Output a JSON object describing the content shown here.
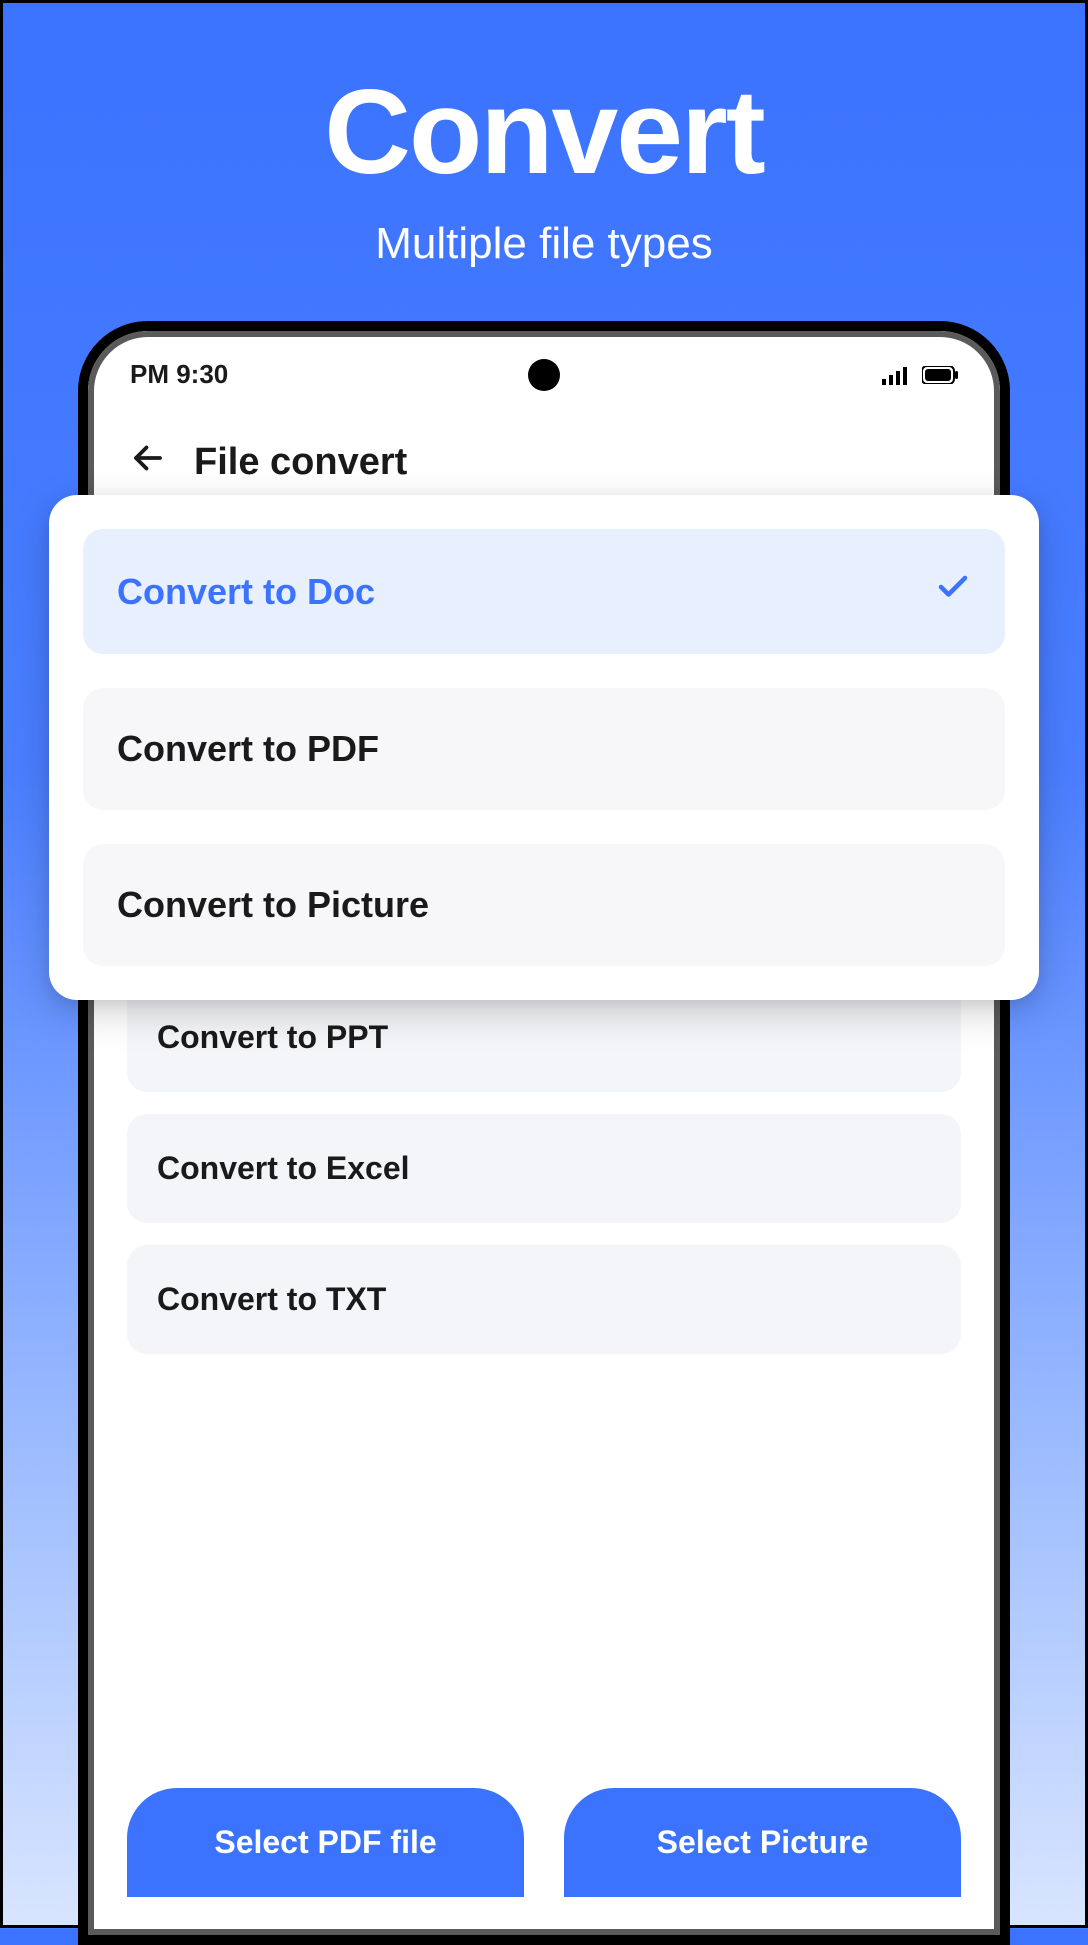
{
  "hero": {
    "title": "Convert",
    "subtitle": "Multiple file types"
  },
  "statusbar": {
    "time": "PM 9:30"
  },
  "header": {
    "title": "File convert"
  },
  "popup_options": [
    {
      "label": "Convert to Doc",
      "selected": true
    },
    {
      "label": "Convert to PDF",
      "selected": false
    },
    {
      "label": "Convert to Picture",
      "selected": false
    }
  ],
  "lower_options": [
    {
      "label": "Convert to PPT"
    },
    {
      "label": "Convert to Excel"
    },
    {
      "label": "Convert to TXT"
    }
  ],
  "buttons": {
    "select_pdf": "Select PDF file",
    "select_picture": "Select Picture"
  }
}
